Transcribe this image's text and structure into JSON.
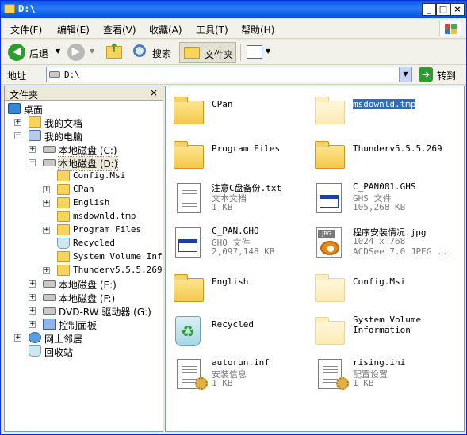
{
  "window": {
    "title": "D:\\",
    "min": "_",
    "max": "□",
    "close": "×"
  },
  "menu": [
    "文件(F)",
    "编辑(E)",
    "查看(V)",
    "收藏(A)",
    "工具(T)",
    "帮助(H)"
  ],
  "toolbar": {
    "back": "后退",
    "search": "搜索",
    "folders": "文件夹"
  },
  "address": {
    "label": "地址",
    "value": "D:\\",
    "go": "转到"
  },
  "left_pane": {
    "title": "文件夹",
    "close": "×",
    "tree": [
      {
        "label": "桌面",
        "icon": "desktop-icon"
      },
      {
        "label": "我的文档",
        "icon": "documents-icon",
        "exp": "+"
      },
      {
        "label": "我的电脑",
        "icon": "computer-icon",
        "exp": "−"
      },
      {
        "label": "本地磁盘 (C:)",
        "icon": "drive-icon",
        "exp": "+"
      },
      {
        "label": "本地磁盘 (D:)",
        "icon": "drive-icon",
        "exp": "−"
      },
      {
        "label": "Config.Msi",
        "icon": "folder-icon"
      },
      {
        "label": "CPan",
        "icon": "folder-icon",
        "exp": "+"
      },
      {
        "label": "English",
        "icon": "folder-icon",
        "exp": "+"
      },
      {
        "label": "msdownld.tmp",
        "icon": "folder-icon"
      },
      {
        "label": "Program Files",
        "icon": "folder-icon",
        "exp": "+"
      },
      {
        "label": "Recycled",
        "icon": "recycle-bin-icon"
      },
      {
        "label": "System Volume Information",
        "icon": "folder-icon"
      },
      {
        "label": "Thunderv5.5.5.269",
        "icon": "folder-icon",
        "exp": "+"
      },
      {
        "label": "本地磁盘 (E:)",
        "icon": "drive-icon",
        "exp": "+"
      },
      {
        "label": "本地磁盘 (F:)",
        "icon": "drive-icon",
        "exp": "+"
      },
      {
        "label": "DVD-RW 驱动器 (G:)",
        "icon": "dvd-drive-icon",
        "exp": "+"
      },
      {
        "label": "控制面板",
        "icon": "control-panel-icon",
        "exp": "+"
      },
      {
        "label": "网上邻居",
        "icon": "network-icon",
        "exp": "+"
      },
      {
        "label": "回收站",
        "icon": "recycle-bin-icon"
      }
    ]
  },
  "files": [
    {
      "name": "CPan",
      "type": "folder"
    },
    {
      "name": "msdownld.tmp",
      "type": "folder-hidden",
      "selected": true
    },
    {
      "name": "Program Files",
      "type": "folder"
    },
    {
      "name": "Thunderv5.5.5.269",
      "type": "folder"
    },
    {
      "name": "注意C盘备份.txt",
      "type": "text",
      "line2": "文本文档",
      "line3": "1 KB"
    },
    {
      "name": "C_PAN001.GHS",
      "type": "app",
      "line2": "GHS 文件",
      "line3": "105,268 KB"
    },
    {
      "name": "C_PAN.GHO",
      "type": "app",
      "line2": "GHO 文件",
      "line3": "2,097,148 KB"
    },
    {
      "name": "程序安装情况.jpg",
      "type": "jpg",
      "line2": "1024 x 768",
      "line3": "ACDSee 7.0 JPEG ..."
    },
    {
      "name": "English",
      "type": "folder"
    },
    {
      "name": "Config.Msi",
      "type": "folder-hidden"
    },
    {
      "name": "Recycled",
      "type": "recycle"
    },
    {
      "name": "System Volume\nInformation",
      "type": "folder-hidden"
    },
    {
      "name": "autorun.inf",
      "type": "config",
      "line2": "安装信息",
      "line3": "1 KB"
    },
    {
      "name": "rising.ini",
      "type": "config",
      "line2": "配置设置",
      "line3": "1 KB"
    }
  ]
}
